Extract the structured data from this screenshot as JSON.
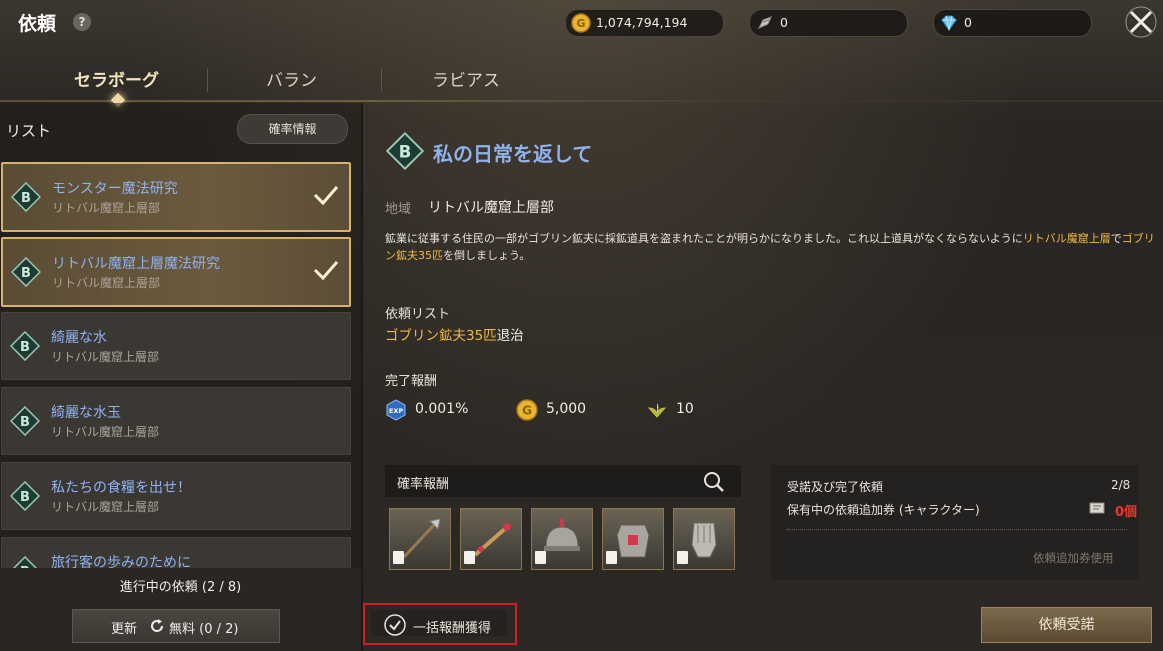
{
  "header": {
    "title": "依頼",
    "help_label": "?",
    "gold": "1,074,794,194",
    "feather": "0",
    "gem": "0"
  },
  "tabs": [
    {
      "label": "セラボーグ",
      "active": true
    },
    {
      "label": "バラン",
      "active": false
    },
    {
      "label": "ラビアス",
      "active": false
    }
  ],
  "list": {
    "title": "リスト",
    "prob_info_button": "確率情報",
    "items": [
      {
        "grade": "B",
        "name": "モンスター魔法研究",
        "location": "リトバル魔窟上層部",
        "completed": true
      },
      {
        "grade": "B",
        "name": "リトバル魔窟上層魔法研究",
        "location": "リトバル魔窟上層部",
        "completed": true
      },
      {
        "grade": "B",
        "name": "綺麗な水",
        "location": "リトバル魔窟上層部",
        "completed": false
      },
      {
        "grade": "B",
        "name": "綺麗な水玉",
        "location": "リトバル魔窟上層部",
        "completed": false
      },
      {
        "grade": "B",
        "name": "私たちの食糧を出せ！",
        "location": "リトバル魔窟上層部",
        "completed": false
      },
      {
        "grade": "B",
        "name": "旅行客の歩みのために",
        "location": "",
        "completed": false
      }
    ],
    "progress": "進行中の依頼 (2 / 8)",
    "refresh_label": "更新",
    "refresh_free": "無料 (0 / 2)"
  },
  "detail": {
    "grade": "B",
    "title": "私の日常を返して",
    "region_label": "地域",
    "region_value": "リトバル魔窟上層部",
    "desc_part1": "鉱業に従事する住民の一部がゴブリン鉱夫に採鉱道具を盗まれたことが明らかになりました。これ以上道具がなくならないように",
    "desc_hl1": "リトバル魔窟上層",
    "desc_part2": "で",
    "desc_hl2": "ゴブリン鉱夫35匹",
    "desc_part3": "を倒しましょう。",
    "quest_list_label": "依頼リスト",
    "quest_target": "ゴブリン鉱夫35匹",
    "quest_action": "退治",
    "reward_label": "完了報酬",
    "rewards": {
      "exp": "0.001%",
      "gold": "5,000",
      "leaf": "10"
    },
    "prob_reward_label": "確率報酬",
    "prob_items": [
      "spear-icon",
      "staff-icon",
      "helmet-icon",
      "armor-icon",
      "gauntlet-icon"
    ],
    "info": {
      "accepted_label": "受諾及び完了依頼",
      "accepted_value": "2/8",
      "ticket_label": "保有中の依頼追加券 (キャラクター)",
      "ticket_value": "0個",
      "use_ticket": "依頼追加券使用"
    },
    "bulk_claim": "一括報酬獲得",
    "accept_button": "依頼受諾"
  }
}
